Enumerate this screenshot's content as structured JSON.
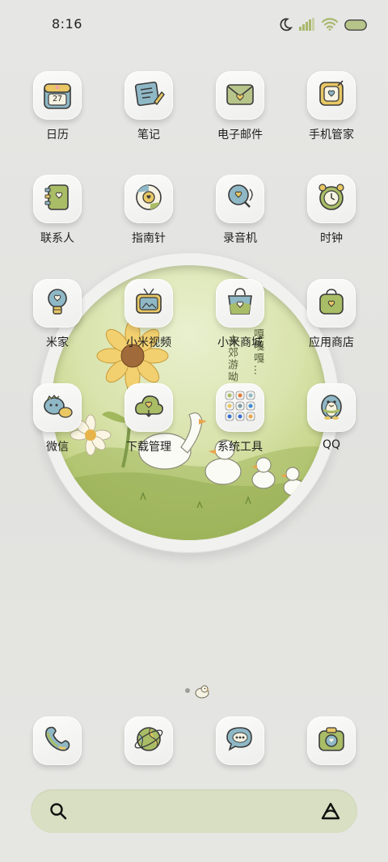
{
  "status_bar": {
    "time": "8:16",
    "icons": [
      "moon-icon",
      "signal-icon",
      "wifi-icon",
      "battery-icon"
    ]
  },
  "wallpaper": {
    "vertical_text": [
      "去郊游呦",
      "嘎嘎嘎…"
    ]
  },
  "apps": [
    {
      "label": "日历",
      "icon": "calendar-icon",
      "badge_text": "27"
    },
    {
      "label": "笔记",
      "icon": "notes-icon"
    },
    {
      "label": "电子邮件",
      "icon": "mail-icon"
    },
    {
      "label": "手机管家",
      "icon": "phone-manager-icon"
    },
    {
      "label": "联系人",
      "icon": "contacts-icon"
    },
    {
      "label": "指南针",
      "icon": "compass-icon"
    },
    {
      "label": "录音机",
      "icon": "recorder-icon"
    },
    {
      "label": "时钟",
      "icon": "clock-icon"
    },
    {
      "label": "米家",
      "icon": "mijia-bulb-icon"
    },
    {
      "label": "小米视频",
      "icon": "tv-icon"
    },
    {
      "label": "小米商城",
      "icon": "shopping-bag-icon"
    },
    {
      "label": "应用商店",
      "icon": "app-store-bag-icon"
    },
    {
      "label": "微信",
      "icon": "wechat-dino-icon"
    },
    {
      "label": "下载管理",
      "icon": "download-cloud-icon"
    },
    {
      "label": "系统工具",
      "icon": "folder-icon"
    },
    {
      "label": "QQ",
      "icon": "penguin-icon"
    }
  ],
  "dock": [
    {
      "icon": "phone-icon"
    },
    {
      "icon": "browser-globe-icon"
    },
    {
      "icon": "messages-bubble-icon"
    },
    {
      "icon": "camera-icon"
    }
  ],
  "colors": {
    "accent_green": "#9fb36a",
    "accent_blue": "#8fb8c6",
    "accent_yellow": "#e8c764",
    "searchbar_bg": "#d8dfc2"
  }
}
